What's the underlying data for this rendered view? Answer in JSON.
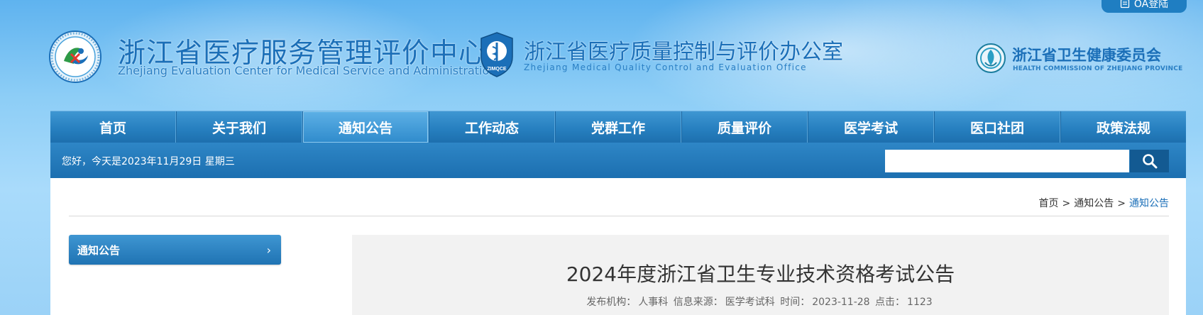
{
  "header": {
    "oa_login": "OA登陆",
    "title": "浙江省医疗服务管理评价中心",
    "subtitle": "Zhejiang Evaluation Center for Medical Service and Administration",
    "partner1_title": "浙江省医疗质量控制与评价办公室",
    "partner1_sub": "Zhejiang Medical Quality Control and Evaluation Office",
    "partner1_logo_text": "ZIMQCE",
    "partner2_title": "浙江省卫生健康委员会",
    "partner2_sub": "HEALTH COMMISSION OF ZHEJIANG PROVINCE"
  },
  "nav": {
    "items": [
      {
        "label": "首页"
      },
      {
        "label": "关于我们"
      },
      {
        "label": "通知公告"
      },
      {
        "label": "工作动态"
      },
      {
        "label": "党群工作"
      },
      {
        "label": "质量评价"
      },
      {
        "label": "医学考试"
      },
      {
        "label": "医口社团"
      },
      {
        "label": "政策法规"
      }
    ],
    "active": "通知公告"
  },
  "subbar": {
    "greeting": "您好，今天是2023年11月29日 星期三",
    "search_value": ""
  },
  "breadcrumb": {
    "home": "首页",
    "sep": ">",
    "level1": "通知公告",
    "current": "通知公告"
  },
  "sidebar": {
    "item": "通知公告",
    "chevron": "›"
  },
  "article": {
    "title": "2024年度浙江省卫生专业技术资格考试公告",
    "org_label": "发布机构：",
    "org": "人事科",
    "source_label": "信息来源：",
    "source": "医学考试科",
    "time_label": "时间：",
    "time": "2023-11-28",
    "clicks_label": "点击：",
    "clicks": "1123"
  },
  "colors": {
    "brand_blue": "#1b6fb8",
    "nav_blue": "#2780c0",
    "search_btn": "#135a92"
  },
  "icons": {
    "oa": "login-icon",
    "search": "search-icon",
    "logo_main": "center-logo-icon",
    "logo_zimqce": "zimqce-shield-icon",
    "logo_commission": "commission-logo-icon"
  }
}
